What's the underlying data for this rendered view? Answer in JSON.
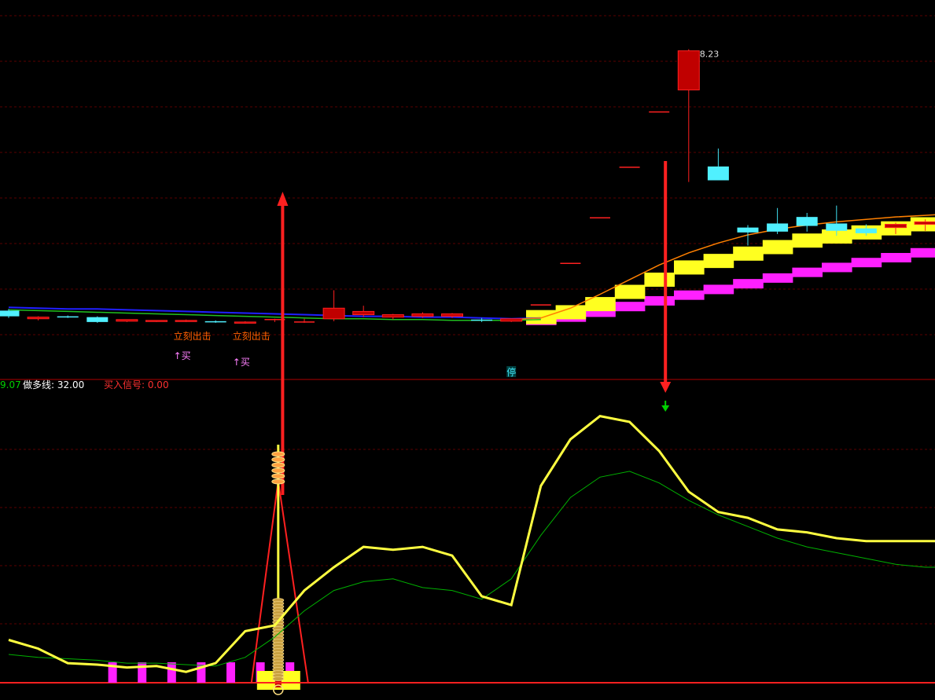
{
  "chart_data": [
    {
      "type": "candlestick",
      "panel": "price",
      "title": "",
      "max_label": "8.23",
      "grid": true,
      "candles": [
        {
          "o": 5.02,
          "h": 5.04,
          "l": 4.93,
          "c": 4.95
        },
        {
          "o": 4.92,
          "h": 4.95,
          "l": 4.9,
          "c": 4.94
        },
        {
          "o": 4.95,
          "h": 4.96,
          "l": 4.93,
          "c": 4.94
        },
        {
          "o": 4.94,
          "h": 4.95,
          "l": 4.87,
          "c": 4.88
        },
        {
          "o": 4.89,
          "h": 4.91,
          "l": 4.88,
          "c": 4.91
        },
        {
          "o": 4.89,
          "h": 4.9,
          "l": 4.88,
          "c": 4.9
        },
        {
          "o": 4.89,
          "h": 4.91,
          "l": 4.88,
          "c": 4.9
        },
        {
          "o": 4.89,
          "h": 4.9,
          "l": 4.87,
          "c": 4.88
        },
        {
          "o": 4.87,
          "h": 4.89,
          "l": 4.86,
          "c": 4.88
        },
        {
          "o": 4.91,
          "h": 4.92,
          "l": 4.88,
          "c": 4.91
        },
        {
          "o": 4.88,
          "h": 4.92,
          "l": 4.87,
          "c": 4.88
        },
        {
          "o": 4.92,
          "h": 5.27,
          "l": 4.89,
          "c": 5.05
        },
        {
          "o": 4.97,
          "h": 5.08,
          "l": 4.94,
          "c": 5.01
        },
        {
          "o": 4.94,
          "h": 4.98,
          "l": 4.91,
          "c": 4.97
        },
        {
          "o": 4.95,
          "h": 5.0,
          "l": 4.93,
          "c": 4.98
        },
        {
          "o": 4.95,
          "h": 4.99,
          "l": 4.93,
          "c": 4.98
        },
        {
          "o": 4.91,
          "h": 4.93,
          "l": 4.88,
          "c": 4.9
        },
        {
          "o": 4.89,
          "h": 4.92,
          "l": 4.88,
          "c": 4.92
        },
        {
          "o": 5.09,
          "h": 5.09,
          "l": 5.09,
          "c": 5.09
        },
        {
          "o": 5.6,
          "h": 5.6,
          "l": 5.6,
          "c": 5.6
        },
        {
          "o": 6.16,
          "h": 6.16,
          "l": 6.16,
          "c": 6.16
        },
        {
          "o": 6.78,
          "h": 6.78,
          "l": 6.78,
          "c": 6.78
        },
        {
          "o": 7.46,
          "h": 7.46,
          "l": 7.46,
          "c": 7.46
        },
        {
          "o": 7.73,
          "h": 8.23,
          "l": 6.6,
          "c": 8.21
        },
        {
          "o": 6.79,
          "h": 7.01,
          "l": 6.79,
          "c": 6.62
        },
        {
          "o": 6.04,
          "h": 6.07,
          "l": 5.82,
          "c": 5.98
        },
        {
          "o": 6.09,
          "h": 6.28,
          "l": 5.96,
          "c": 5.99
        },
        {
          "o": 6.17,
          "h": 6.22,
          "l": 5.99,
          "c": 6.06
        },
        {
          "o": 6.09,
          "h": 6.31,
          "l": 5.94,
          "c": 6.0
        },
        {
          "o": 6.03,
          "h": 6.08,
          "l": 5.94,
          "c": 5.97
        },
        {
          "o": 6.04,
          "h": 6.1,
          "l": 5.96,
          "c": 6.08
        },
        {
          "o": 6.08,
          "h": 6.14,
          "l": 6.0,
          "c": 6.11
        },
        {
          "o": 6.07,
          "h": 6.12,
          "l": 5.96,
          "c": 6.14
        }
      ],
      "band_upper": [
        null,
        null,
        null,
        null,
        null,
        null,
        null,
        null,
        null,
        null,
        null,
        null,
        null,
        null,
        null,
        null,
        null,
        null,
        4.94,
        5.0,
        5.1,
        5.25,
        5.4,
        5.55,
        5.63,
        5.72,
        5.8,
        5.88,
        5.93,
        5.98,
        6.03,
        6.08,
        6.13
      ],
      "band_lower": [
        null,
        null,
        null,
        null,
        null,
        null,
        null,
        null,
        null,
        null,
        null,
        null,
        null,
        null,
        null,
        null,
        null,
        null,
        4.9,
        4.94,
        5.0,
        5.07,
        5.14,
        5.21,
        5.28,
        5.35,
        5.42,
        5.49,
        5.55,
        5.61,
        5.67,
        5.73,
        5.79
      ],
      "ma_blue": [
        5.06,
        5.05,
        5.04,
        5.04,
        5.03,
        5.02,
        5.01,
        5.0,
        4.99,
        4.98,
        4.97,
        4.96,
        4.95,
        4.95,
        4.94,
        4.94,
        4.93,
        4.92,
        4.93,
        null,
        null,
        null,
        null,
        null,
        null,
        null,
        null,
        null,
        null,
        null,
        null,
        null,
        null
      ],
      "ma_green": [
        5.03,
        5.02,
        5.01,
        5.0,
        4.99,
        4.98,
        4.97,
        4.96,
        4.95,
        4.94,
        4.93,
        4.92,
        4.92,
        4.91,
        4.91,
        4.9,
        4.9,
        4.9,
        4.91,
        null,
        null,
        null,
        null,
        null,
        null,
        null,
        null,
        null,
        null,
        null,
        null,
        null,
        null
      ],
      "ma_orange": [
        null,
        null,
        null,
        null,
        null,
        null,
        null,
        null,
        null,
        null,
        null,
        null,
        null,
        null,
        null,
        null,
        null,
        4.91,
        4.93,
        5.05,
        5.22,
        5.4,
        5.58,
        5.73,
        5.85,
        5.95,
        6.02,
        6.07,
        6.11,
        6.14,
        6.17,
        6.19,
        6.21
      ],
      "labels": [
        {
          "bar": 6,
          "text": "立刻出击"
        },
        {
          "bar": 8,
          "text": "立刻出击"
        },
        {
          "bar": 6,
          "text": "↑买"
        },
        {
          "bar": 8,
          "text": "↑买"
        },
        {
          "bar": 17,
          "text": "停"
        }
      ]
    },
    {
      "type": "line",
      "panel": "indicator",
      "title": "",
      "ylim": [
        0,
        100
      ],
      "legend": [
        {
          "text": "9.07",
          "color": "#00d000"
        },
        {
          "text": "做多线: 32.00",
          "color": "#ffffff"
        },
        {
          "text": "买入信号: 0.00",
          "color": "#ff3030"
        }
      ],
      "series": [
        {
          "color": "#ffff40",
          "values": [
            15,
            12,
            7,
            6.5,
            5.5,
            6,
            4,
            7,
            18,
            20,
            32,
            40,
            47,
            46,
            47,
            44,
            30,
            27,
            68,
            84,
            92,
            90,
            80,
            66,
            59,
            57,
            53,
            52,
            50,
            49,
            49,
            49,
            49
          ]
        },
        {
          "color": "#00b000",
          "values": [
            10,
            9,
            8.5,
            8,
            7,
            7,
            6.5,
            6,
            9,
            16,
            25,
            32,
            35,
            36,
            33,
            32,
            29,
            36,
            51,
            64,
            71,
            73,
            69,
            63,
            58,
            54,
            50,
            47,
            45,
            43,
            41,
            40,
            40
          ]
        }
      ],
      "magenta_bars": [
        1,
        2,
        3,
        4,
        5,
        6,
        7
      ],
      "signal_bar": 8
    }
  ]
}
